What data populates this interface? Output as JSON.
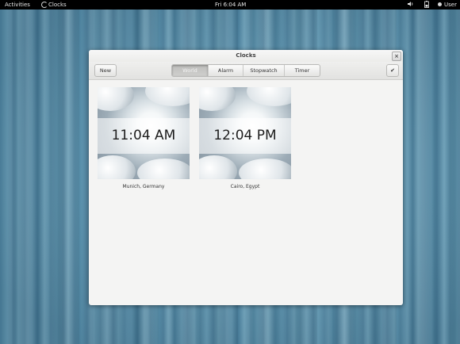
{
  "topbar": {
    "activities_label": "Activities",
    "app_menu_label": "Clocks",
    "clock_text": "Fri 6:04 AM",
    "volume_icon": "speaker-icon",
    "battery_icon": "battery-icon",
    "user_label": "User"
  },
  "window": {
    "title": "Clocks",
    "close_glyph": "×"
  },
  "toolbar": {
    "new_label": "New",
    "done_glyph": "✔",
    "tabs": [
      {
        "label": "World",
        "active": true
      },
      {
        "label": "Alarm",
        "active": false
      },
      {
        "label": "Stopwatch",
        "active": false
      },
      {
        "label": "Timer",
        "active": false
      }
    ]
  },
  "clocks": [
    {
      "time": "11:04 AM",
      "location": "Munich, Germany"
    },
    {
      "time": "12:04 PM",
      "location": "Cairo, Egypt"
    }
  ]
}
